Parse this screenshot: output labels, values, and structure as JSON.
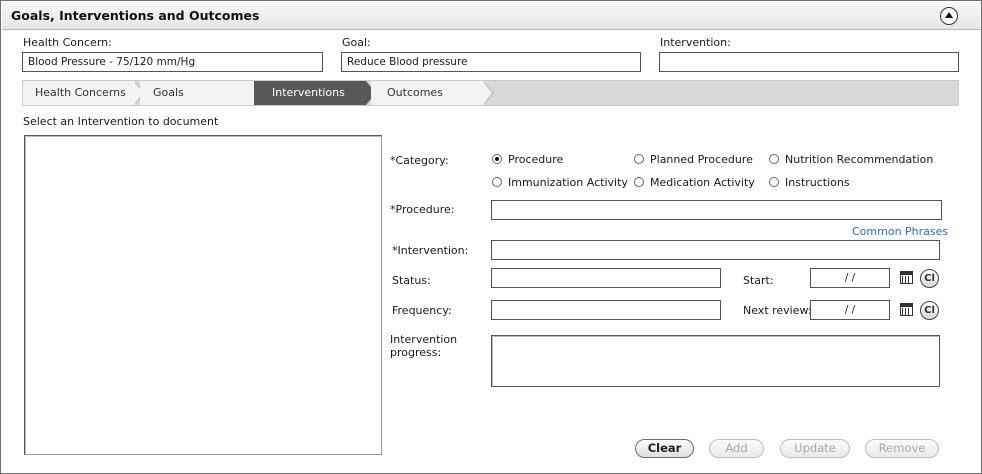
{
  "panel": {
    "title": "Goals, Interventions and Outcomes"
  },
  "summary": {
    "health_concern_label": "Health Concern:",
    "health_concern_value": "Blood Pressure - 75/120 mm/Hg",
    "goal_label": "Goal:",
    "goal_value": "Reduce Blood pressure",
    "intervention_label": "Intervention:",
    "intervention_value": ""
  },
  "tabs": [
    {
      "label": "Health Concerns",
      "active": false
    },
    {
      "label": "Goals",
      "active": false
    },
    {
      "label": "Interventions",
      "active": true
    },
    {
      "label": "Outcomes",
      "active": false
    }
  ],
  "left": {
    "instruction": "Select an Intervention to document"
  },
  "form": {
    "category_label": "*Category:",
    "categories": [
      {
        "label": "Procedure",
        "checked": true
      },
      {
        "label": "Planned Procedure",
        "checked": false
      },
      {
        "label": "Nutrition Recommendation",
        "checked": false
      },
      {
        "label": "Immunization Activity",
        "checked": false
      },
      {
        "label": "Medication Activity",
        "checked": false
      },
      {
        "label": "Instructions",
        "checked": false
      }
    ],
    "procedure_label": "*Procedure:",
    "procedure_value": "",
    "common_phrases": "Common Phrases",
    "intervention_label": "*Intervention:",
    "intervention_value": "",
    "status_label": "Status:",
    "status_value": "",
    "start_label": "Start:",
    "start_value": "/ /",
    "frequency_label": "Frequency:",
    "frequency_value": "",
    "next_review_label": "Next review:",
    "next_review_value": "/ /",
    "progress_label_1": "Intervention",
    "progress_label_2": "progress:",
    "clear_icon_text": "Cl"
  },
  "actions": {
    "clear": "Clear",
    "add": "Add",
    "update": "Update",
    "remove": "Remove"
  },
  "icons": [
    "collapse-up-icon",
    "calendar-icon",
    "clear-date-icon",
    "radio-button-icon"
  ]
}
